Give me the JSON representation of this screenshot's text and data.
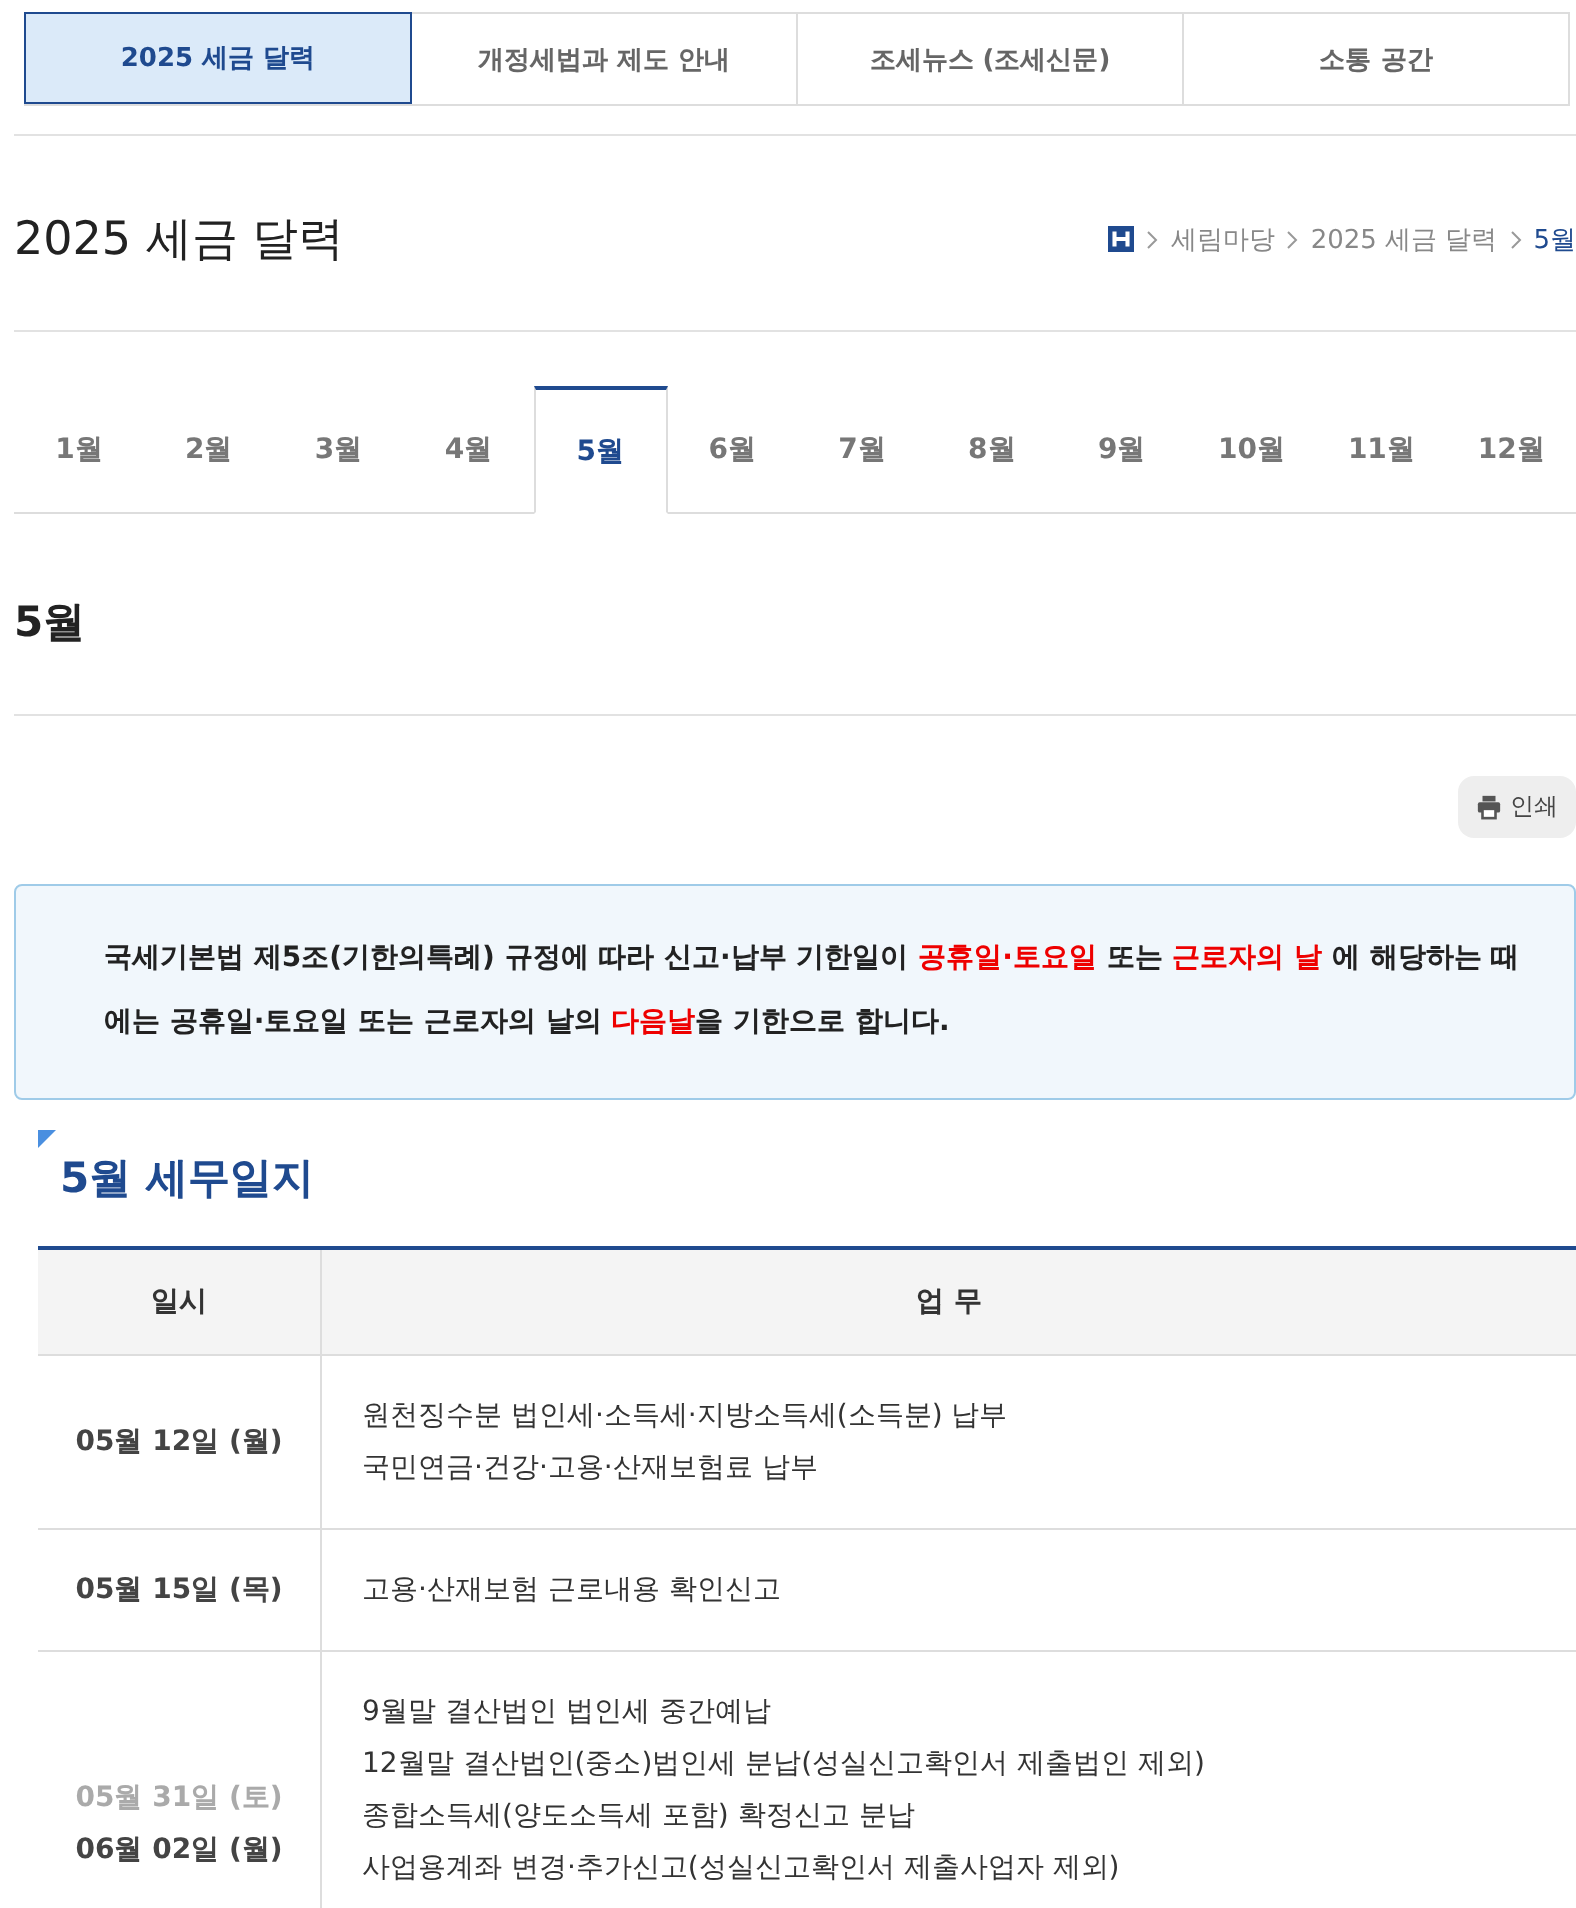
{
  "top_tabs": [
    {
      "label": "2025 세금 달력",
      "selected": true
    },
    {
      "label": "개정세법과 제도 안내",
      "selected": false
    },
    {
      "label": "조세뉴스 (조세신문)",
      "selected": false
    },
    {
      "label": "소통 공간",
      "selected": false
    }
  ],
  "page_title": "2025 세금 달력",
  "breadcrumb": [
    {
      "label": "세림마당",
      "current": false
    },
    {
      "label": "2025 세금 달력",
      "current": false
    },
    {
      "label": "5월",
      "current": true
    }
  ],
  "month_tabs": [
    {
      "label": "1월",
      "selected": false
    },
    {
      "label": "2월",
      "selected": false
    },
    {
      "label": "3월",
      "selected": false
    },
    {
      "label": "4월",
      "selected": false
    },
    {
      "label": "5월",
      "selected": true
    },
    {
      "label": "6월",
      "selected": false
    },
    {
      "label": "7월",
      "selected": false
    },
    {
      "label": "8월",
      "selected": false
    },
    {
      "label": "9월",
      "selected": false
    },
    {
      "label": "10월",
      "selected": false
    },
    {
      "label": "11월",
      "selected": false
    },
    {
      "label": "12월",
      "selected": false
    }
  ],
  "month_heading": "5월",
  "print_button": "인쇄",
  "notice": [
    {
      "text": "국세기본법 제5조(기한의특례) 규정에 따라 신고·납부 기한일이 ",
      "highlight": false
    },
    {
      "text": "공휴일·토요일",
      "highlight": true
    },
    {
      "text": " 또는 ",
      "highlight": false
    },
    {
      "text": "근로자의 날",
      "highlight": true
    },
    {
      "text": " 에 해당하는 때에는 공휴일·토요일 또는 근로자의 날의 ",
      "highlight": false
    },
    {
      "text": "다음날",
      "highlight": true
    },
    {
      "text": "을 기한으로 합니다.",
      "highlight": false
    }
  ],
  "section_title": "5월 세무일지",
  "table": {
    "columns": [
      "일시",
      "업 무"
    ],
    "rows": [
      {
        "dates": [
          {
            "text": "05월 12일 (월)",
            "muted": false
          }
        ],
        "tasks": [
          "원천징수분 법인세·소득세·지방소득세(소득분) 납부",
          "국민연금·건강·고용·산재보험료 납부"
        ]
      },
      {
        "dates": [
          {
            "text": "05월 15일 (목)",
            "muted": false
          }
        ],
        "tasks": [
          "고용·산재보험 근로내용 확인신고"
        ]
      },
      {
        "dates": [
          {
            "text": "05월 31일 (토)",
            "muted": true
          },
          {
            "text": "06월 02일 (월)",
            "muted": false
          }
        ],
        "tasks": [
          "9월말 결산법인 법인세 중간예납",
          "12월말 결산법인(중소)법인세 분납(성실신고확인서 제출법인 제외)",
          "종합소득세(양도소득세 포함) 확정신고 분납",
          "사업용계좌 변경·추가신고(성실신고확인서 제출사업자 제외)"
        ]
      }
    ]
  }
}
